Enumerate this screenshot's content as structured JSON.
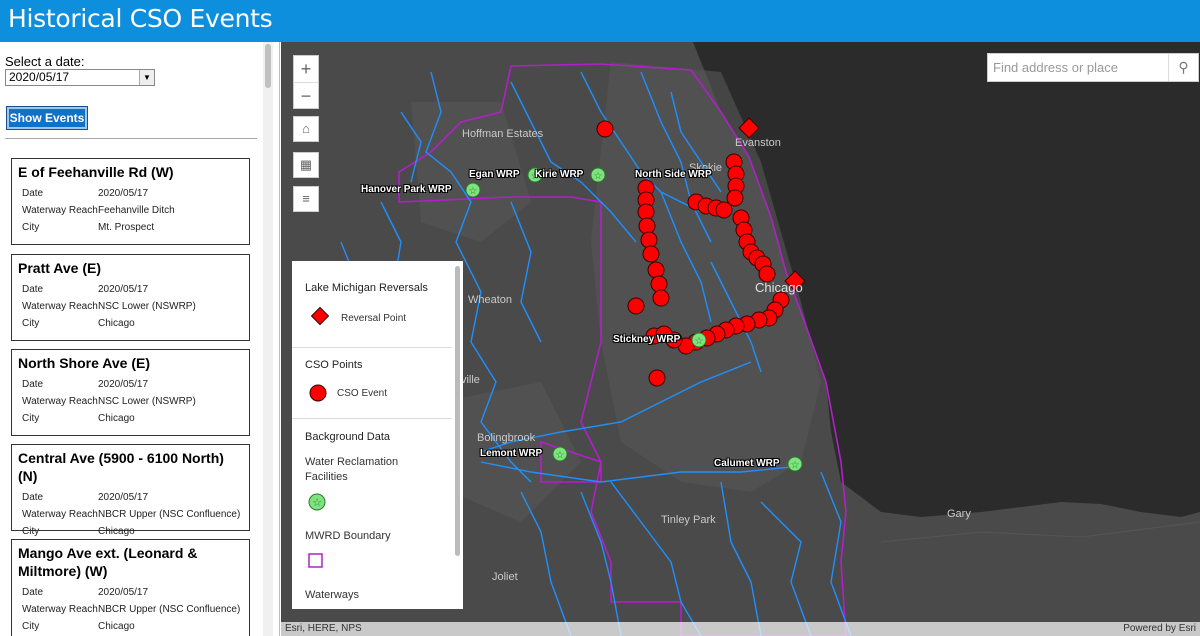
{
  "app": {
    "title": "Historical CSO Events"
  },
  "sidebar": {
    "date_label": "Select a date:",
    "date_value": "2020/05/17",
    "show_button": "Show Events",
    "labels": {
      "date": "Date",
      "reach": "Waterway Reach",
      "city": "City"
    },
    "events": [
      {
        "title": "E of Feehanville Rd (W)",
        "date": "2020/05/17",
        "reach": "Feehanville Ditch",
        "city": "Mt. Prospect"
      },
      {
        "title": "Pratt Ave (E)",
        "date": "2020/05/17",
        "reach": "NSC Lower (NSWRP)",
        "city": "Chicago"
      },
      {
        "title": "North Shore Ave (E)",
        "date": "2020/05/17",
        "reach": "NSC Lower (NSWRP)",
        "city": "Chicago"
      },
      {
        "title": "Central Ave (5900 - 6100 North) (N)",
        "date": "2020/05/17",
        "reach": "NBCR Upper (NSC Confluence)",
        "city": "Chicago"
      },
      {
        "title": "Mango Ave ext. (Leonard & Miltmore) (W)",
        "date": "2020/05/17",
        "reach": "NBCR Upper (NSC Confluence)",
        "city": "Chicago"
      }
    ]
  },
  "map": {
    "search_placeholder": "Find address or place",
    "zoom_in": "+",
    "zoom_out": "−",
    "attribution_left": "Esri, HERE, NPS",
    "attribution_right": "Powered by Esri",
    "colors": {
      "cso": "#ff0000",
      "wrp": "#7ee37e",
      "boundary": "#b120c8",
      "waterways": "#1e90ff",
      "lake": "#2b2b2b",
      "land": "#4a4a4a"
    },
    "wrp_labels": {
      "egan": "Egan WRP",
      "kirie": "Kirie WRP",
      "northside": "North Side WRP",
      "hanover": "Hanover Park WRP",
      "stickney": "Stickney WRP",
      "lemont": "Lemont WRP",
      "calumet": "Calumet WRP"
    },
    "towns": {
      "hoffman": "Hoffman Estates",
      "evanston": "Evanston",
      "skokie": "Skokie",
      "wheaton": "Wheaton",
      "naperville": "Naperville",
      "bolingbrook": "Bolingbrook",
      "tinley": "Tinley Park",
      "joliet": "Joliet",
      "gary": "Gary",
      "chicago": "Chicago"
    }
  },
  "legend": {
    "reversals_title": "Lake Michigan Reversals",
    "reversal_point": "Reversal Point",
    "cso_title": "CSO Points",
    "cso_event": "CSO Event",
    "background_title": "Background Data",
    "wrf": "Water Reclamation Facilities",
    "boundary": "MWRD Boundary",
    "waterways": "Waterways"
  }
}
